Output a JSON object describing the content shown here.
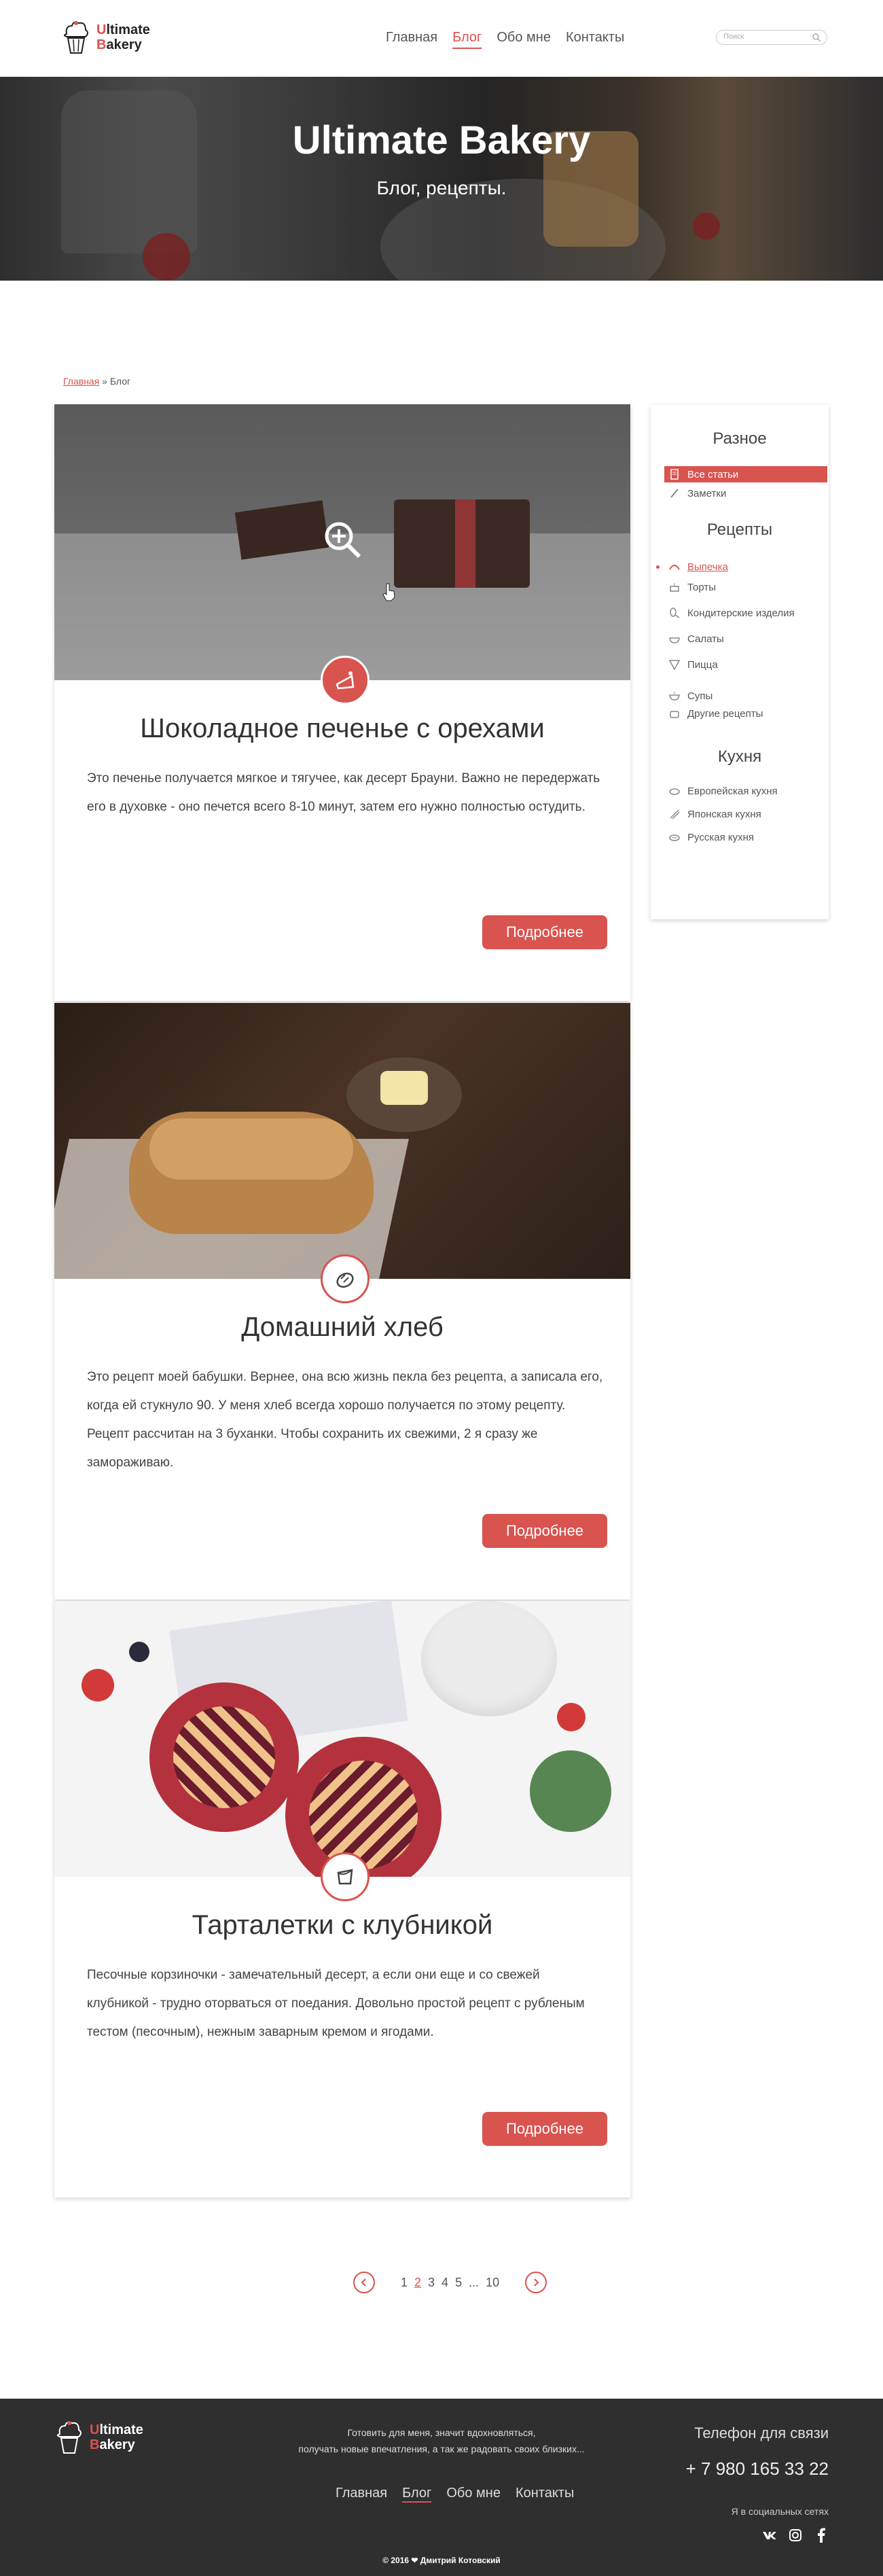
{
  "brand": {
    "first_line_initial": "U",
    "first_line_rest": "ltimate",
    "second_line_initial": "B",
    "second_line_rest": "akery"
  },
  "nav": [
    "Главная",
    "Блог",
    "Обо мне",
    "Контакты"
  ],
  "nav_active": "Блог",
  "search": {
    "placeholder": "Поиск"
  },
  "hero": {
    "title": "Ultimate Bakery",
    "subtitle": "Блог, рецепты."
  },
  "breadcrumb": {
    "home": "Главная",
    "separator": "»",
    "current": "Блог"
  },
  "posts": [
    {
      "title": "Шоколадное печенье с орехами",
      "text": "Это печенье получается мягкое и тягучее, как десерт Брауни. Важно не передержать его в духовке - оно печется всего 8-10 минут, затем его нужно полностью остудить.",
      "button": "Подробнее",
      "badge_icon": "cake-slice-icon"
    },
    {
      "title": "Домашний хлеб",
      "text": "Это рецепт моей бабушки. Вернее, она всю жизнь пекла без рецепта, а записала его, когда ей стукнуло 90. У меня хлеб всегда хорошо получается по этому рецепту. Рецепт рассчитан на 3 буханки. Чтобы сохранить их свежими, 2 я сразу же замораживаю.",
      "button": "Подробнее",
      "badge_icon": "bread-icon"
    },
    {
      "title": "Тарталетки с клубникой",
      "text": "Песочные корзиночки - замечательный десерт, а если они еще и со свежей клубникой - трудно оторваться от поедания. Довольно простой рецепт с рубленым тестом (песочным), нежным заварным кремом и ягодами.",
      "button": "Подробнее",
      "badge_icon": "tart-icon"
    }
  ],
  "sidebar": {
    "misc_title": "Разное",
    "misc": [
      "Все статьи",
      "Заметки"
    ],
    "recipes_title": "Рецепты",
    "recipes": [
      "Выпечка",
      "Торты",
      "Кондитерские изделия",
      "Салаты",
      "Пицца",
      "Супы",
      "Другие рецепты"
    ],
    "cuisine_title": "Кухня",
    "cuisine": [
      "Европейская кухня",
      "Японская кухня",
      "Русская кухня"
    ]
  },
  "pagination": {
    "pages": [
      "1",
      "2",
      "3",
      "4",
      "5",
      "...",
      "10"
    ],
    "current": "2"
  },
  "footer": {
    "slogan_1": "Готовить для меня, значит вдохновляться,",
    "slogan_2": "получать новые впечатления, а так же радовать своих близких...",
    "phone_label": "Телефон для связи",
    "phone": "+ 7 980 165 33 22",
    "social_label": "Я в социальных сетях",
    "social": [
      "vk-icon",
      "instagram-icon",
      "facebook-icon"
    ],
    "copyright": "© 2016 ❤ Дмитрий Котовский"
  },
  "colors": {
    "accent": "#d9534f",
    "footer_bg": "#2f2f2f"
  }
}
